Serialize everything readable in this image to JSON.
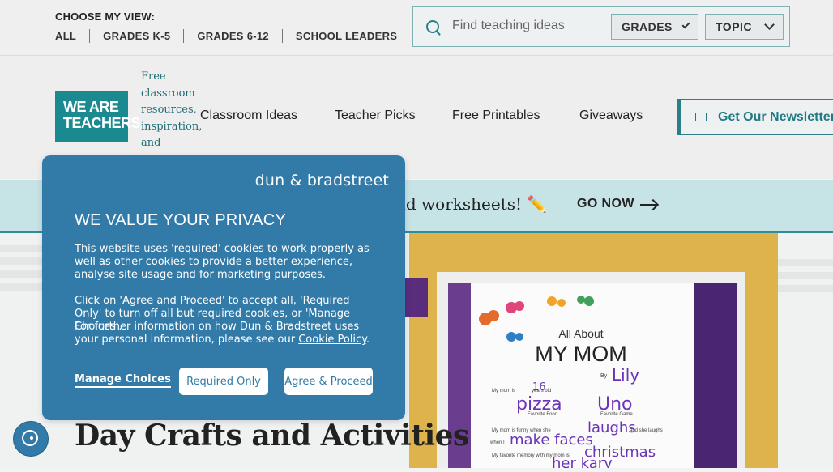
{
  "view_switch": {
    "label": "CHOOSE MY VIEW:",
    "links": [
      "ALL",
      "GRADES K-5",
      "GRADES 6-12",
      "SCHOOL LEADERS"
    ]
  },
  "search": {
    "placeholder": "Find teaching ideas",
    "grades_label": "GRADES",
    "topic_label": "TOPIC"
  },
  "brand": {
    "logo_text_1": "WE ARE",
    "logo_text_2": "TEACHERS",
    "tagline": "Free classroom resources, inspiration, and"
  },
  "nav": {
    "items": [
      "Classroom Ideas",
      "Teacher Picks",
      "Free Printables",
      "Giveaways"
    ],
    "newsletter": "Get Our Newsletter"
  },
  "banner": {
    "text": "nd worksheets! ✏️",
    "cta": "GO NOW"
  },
  "article": {
    "title": "Day Crafts and Activities"
  },
  "hero_image": {
    "heading_small": "All About",
    "heading_big": "MY MOM",
    "by": "By",
    "name": "Lily",
    "age": "16",
    "food": "pizza",
    "game": "Uno",
    "funny": "laughs",
    "funny2": "make faces",
    "memory": "christmas",
    "memory2": "her kary",
    "line_age": "My mom is _____ years old",
    "line_food": "Favorite Food",
    "line_game": "Favorite Game",
    "line_funny": "My mom is funny when she",
    "line_laugh": "and she laughs",
    "line_when": "when I",
    "line_memory": "My favorite memory with my mom is"
  },
  "consent": {
    "brand": "dun & bradstreet",
    "title": "WE VALUE YOUR PRIVACY",
    "p1": "This website uses 'required' cookies to work properly as well as other cookies to provide a better experience, analyse site usage and for marketing purposes.",
    "p2": "Click on 'Agree and Proceed' to accept all, 'Required Only' to turn off all but required cookies, or 'Manage Choices'.",
    "p3_prefix": "For further information on how Dun & Bradstreet uses your personal information, please see our ",
    "p3_link": "Cookie Policy",
    "p3_suffix": ".",
    "manage": "Manage Choices",
    "required": "Required Only",
    "agree": "Agree & Proceed"
  },
  "colors": {
    "teal": "#1b8a90",
    "modal_blue": "#327ba8",
    "hero_gold": "#deb34c"
  }
}
